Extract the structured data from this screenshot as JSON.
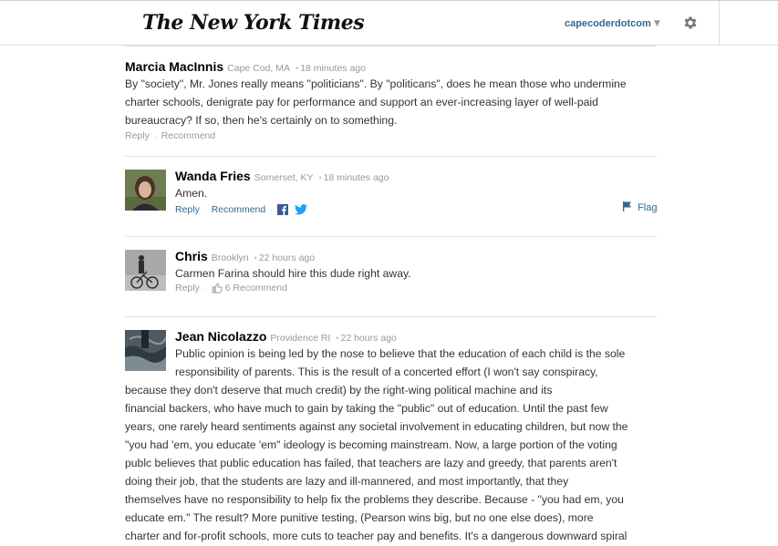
{
  "header": {
    "logo": "The New York Times",
    "username": "capecoderdotcom",
    "caret": "▼"
  },
  "comments": [
    {
      "name": "Marcia MacInnis",
      "location": "Cape Cod, MA",
      "time": "18 minutes ago",
      "text": "By \"society\", Mr. Jones really means \"politicians\". By \"politicans\", does he mean those who undermine charter schools, denigrate pay for performance and support an ever-increasing layer of well-paid bureaucracy? If so, then he's certainly on to something.",
      "reply": "Reply",
      "recommend": "Recommend"
    },
    {
      "name": "Wanda Fries",
      "location": "Somerset, KY",
      "time": "18 minutes ago",
      "text": "Amen.",
      "reply": "Reply",
      "recommend": "Recommend",
      "flag": "Flag"
    },
    {
      "name": "Chris",
      "location": "Brooklyn",
      "time": "22 hours ago",
      "text": "Carmen Farina should hire this dude right away.",
      "reply": "Reply",
      "recommend_count": "6",
      "recommend": "Recommend"
    },
    {
      "name": "Jean Nicolazzo",
      "location": "Providence RI",
      "time": "22 hours ago",
      "lines": [
        "Public opinion is being led by the nose to believe that the education of each child is the sole",
        "responsibility of parents. This is the result of a concerted effort (I won't say conspiracy,",
        "because they don't deserve that much credit) by the right-wing political machine and its",
        "financial backers, who have much to gain by taking the \"public\" out of education. Until the past few",
        "years, one rarely heard sentiments against any societal involvement in educating children, but now the",
        "\"you had 'em, you educate 'em\" ideology is becoming mainstream. Now, a large portion of the voting",
        "publc believes that public education has failed, that teachers are lazy and greedy, that parents aren't",
        "doing their job, that the students are lazy and ill-mannered, and most importantly, that they",
        "themselves have no responsibility to help fix the problems they describe. Because - \"you had em, you",
        "educate em.\" The result? More punitive testing, (Pearson wins big, but no one else does), more",
        "charter and for-profit schools, more cuts to teacher pay and benefits. It's a dangerous downward spiral"
      ]
    }
  ],
  "colors": {
    "link": "#326891",
    "meta": "#999999",
    "divider": "#e2e2e2"
  }
}
